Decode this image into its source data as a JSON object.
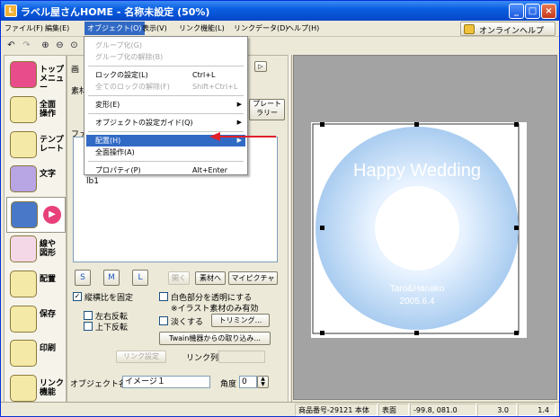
{
  "window": {
    "title": "ラベル屋さんHOME - 名称未設定 (50%)",
    "app_icon": "L"
  },
  "menubar": {
    "items": [
      "ファイル(F)",
      "編集(E)",
      "オブジェクト(O)",
      "表示(V)",
      "リンク機能(L)",
      "リンクデータ(D)",
      "ヘルプ(H)"
    ],
    "active_index": 2,
    "help_button": "オンラインヘルプ"
  },
  "sidebar": {
    "items": [
      {
        "label": "トップ\nメニュー",
        "icon": "home-icon",
        "color": "#E84C8B"
      },
      {
        "label": "全面\n操作",
        "icon": "full-page-icon",
        "color": "#F5E9A8"
      },
      {
        "label": "テンプ\nレート",
        "icon": "template-icon",
        "color": "#F5E9A8"
      },
      {
        "label": "文字",
        "icon": "text-a-icon",
        "color": "#B8A5E3"
      },
      {
        "label": "",
        "icon": "image-paint-icon",
        "color": "#4A78C8"
      },
      {
        "label": "線や\n図形",
        "icon": "shapes-icon",
        "color": "#F5D8E8"
      },
      {
        "label": "配置",
        "icon": "layout-icon",
        "color": "#F5E9A8"
      },
      {
        "label": "保存",
        "icon": "save-icon",
        "color": "#F5E9A8"
      },
      {
        "label": "印刷",
        "icon": "print-icon",
        "color": "#F5E9A8"
      },
      {
        "label": "リンク\n機能",
        "icon": "link-icon",
        "color": "#F5E9A8"
      }
    ],
    "selected_index": 4
  },
  "panel": {
    "label_image": "画",
    "label_material": "素材",
    "label_file": "ファ",
    "list_items": [
      "lb1"
    ],
    "template_button": "プレート\nラリー",
    "btn_replace": "開く",
    "btn_material": "素材へ",
    "btn_mypicture": "マイピクチャ",
    "chk_aspect": "縦横比を固定",
    "chk_aspect_checked": true,
    "chk_fliph": "左右反転",
    "chk_flipv": "上下反転",
    "chk_white": "白色部分を透明にする",
    "note_white": "※イラスト素材のみ有効",
    "chk_light": "淡くする",
    "btn_trim": "トリミング...",
    "btn_twain": "Twain機器からの取り込み...",
    "btn_link_setting": "リンク設定",
    "label_link_col": "リンク列",
    "label_objname": "オブジェクト名",
    "objname_value": "イメージ１",
    "label_angle": "角度",
    "angle_value": "0"
  },
  "dropdown": {
    "items": [
      {
        "label": "グループ化(G)",
        "shortcut": "",
        "disabled": true,
        "arrow": false,
        "sep_after": false
      },
      {
        "label": "グループ化の解除(B)",
        "shortcut": "",
        "disabled": true,
        "arrow": false,
        "sep_after": true
      },
      {
        "label": "ロックの設定(L)",
        "shortcut": "Ctrl+L",
        "disabled": false,
        "arrow": false,
        "sep_after": false
      },
      {
        "label": "全てのロックの解除(F)",
        "shortcut": "Shift+Ctrl+L",
        "disabled": true,
        "arrow": false,
        "sep_after": true
      },
      {
        "label": "変形(E)",
        "shortcut": "",
        "disabled": false,
        "arrow": true,
        "sep_after": true
      },
      {
        "label": "オブジェクトの設定ガイド(Q)",
        "shortcut": "",
        "disabled": false,
        "arrow": true,
        "sep_after": true
      },
      {
        "label": "配置(H)",
        "shortcut": "",
        "disabled": false,
        "arrow": true,
        "highlight": true,
        "sep_after": false
      },
      {
        "label": "全面操作(A)",
        "shortcut": "",
        "disabled": false,
        "arrow": false,
        "sep_after": true
      },
      {
        "label": "プロパティ(P)",
        "shortcut": "Alt+Enter",
        "disabled": false,
        "arrow": false,
        "sep_after": false
      }
    ]
  },
  "canvas": {
    "disc_title": "Happy Wedding",
    "disc_names": "Taro&Hanako",
    "disc_date": "2005.6.4",
    "disc_color": "#A9CCF0"
  },
  "statusbar": {
    "product": "商品番号-29121 本体",
    "side": "表面",
    "coords": "-99.8, 081.0",
    "size": "3.0",
    "size2": "1.4"
  },
  "colors": {
    "accent": "#316AC5",
    "arrow": "#E0202A"
  }
}
